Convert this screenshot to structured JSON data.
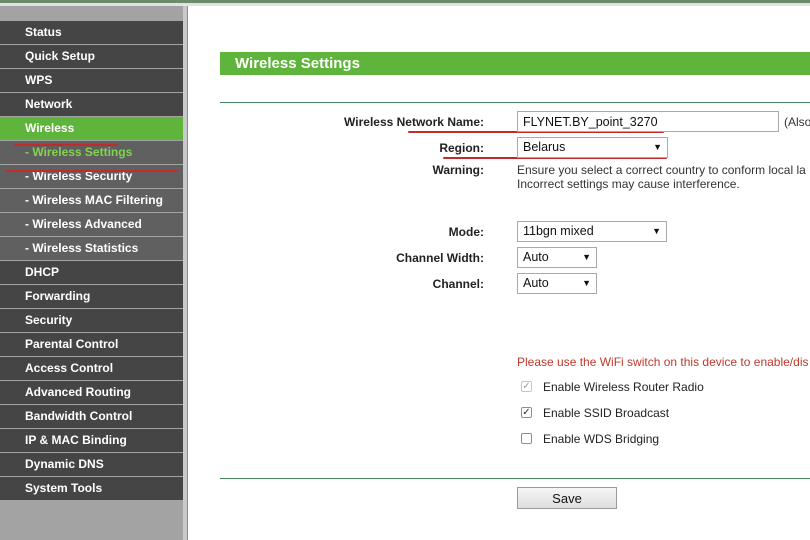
{
  "sidebar": {
    "items": [
      {
        "label": "Status"
      },
      {
        "label": "Quick Setup"
      },
      {
        "label": "WPS"
      },
      {
        "label": "Network"
      },
      {
        "label": "Wireless"
      },
      {
        "label": "- Wireless Settings"
      },
      {
        "label": "- Wireless Security"
      },
      {
        "label": "- Wireless MAC Filtering"
      },
      {
        "label": "- Wireless Advanced"
      },
      {
        "label": "- Wireless Statistics"
      },
      {
        "label": "DHCP"
      },
      {
        "label": "Forwarding"
      },
      {
        "label": "Security"
      },
      {
        "label": "Parental Control"
      },
      {
        "label": "Access Control"
      },
      {
        "label": "Advanced Routing"
      },
      {
        "label": "Bandwidth Control"
      },
      {
        "label": "IP & MAC Binding"
      },
      {
        "label": "Dynamic DNS"
      },
      {
        "label": "System Tools"
      }
    ]
  },
  "main": {
    "title": "Wireless Settings",
    "network_name_label": "Wireless Network Name:",
    "network_name_value": "FLYNET.BY_point_3270",
    "network_name_suffix": "(Also",
    "region_label": "Region:",
    "region_value": "Belarus",
    "warning_label": "Warning:",
    "warning_line1": "Ensure you select a correct country to conform local la",
    "warning_line2": "Incorrect settings may cause interference.",
    "mode_label": "Mode:",
    "mode_value": "11bgn mixed",
    "channel_width_label": "Channel Width:",
    "channel_width_value": "Auto",
    "channel_label": "Channel:",
    "channel_value": "Auto",
    "wifi_switch_notice": "Please use the WiFi switch on this device to enable/dis",
    "checkboxes": [
      {
        "label": "Enable Wireless Router Radio",
        "checked": true,
        "disabled": true
      },
      {
        "label": "Enable SSID Broadcast",
        "checked": true,
        "disabled": false
      },
      {
        "label": "Enable WDS Bridging",
        "checked": false,
        "disabled": false
      }
    ],
    "save_label": "Save"
  },
  "colors": {
    "accent_green": "#5fb43b",
    "menu_bg": "#454545",
    "annotation_red": "#c42a2a"
  }
}
